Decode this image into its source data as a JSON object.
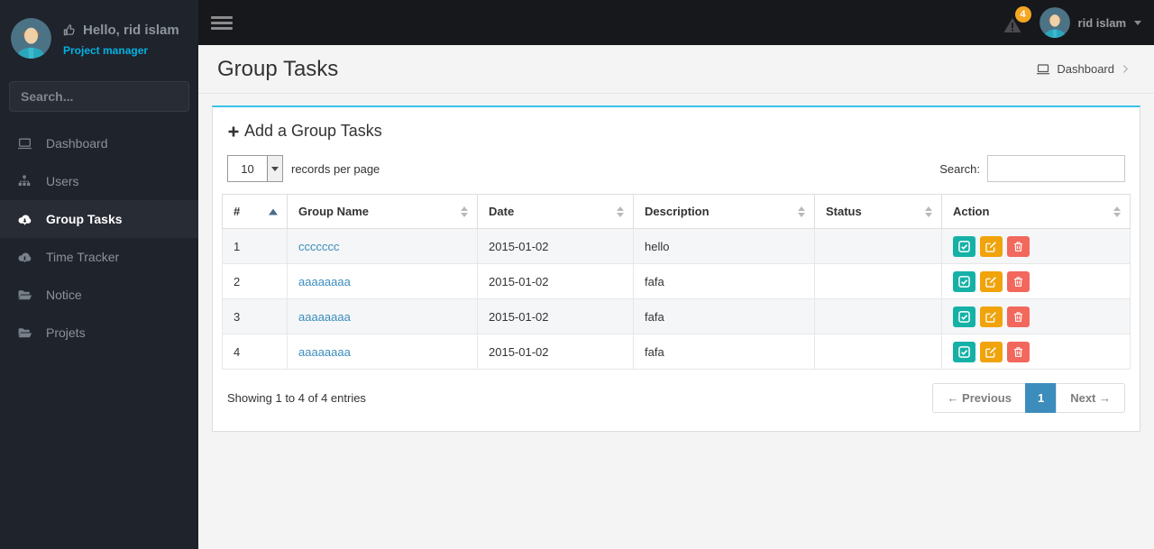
{
  "sidebar": {
    "user": {
      "greeting": "Hello, rid islam",
      "role": "Project manager"
    },
    "search_placeholder": "Search...",
    "items": [
      {
        "label": "Dashboard",
        "icon": "laptop-icon",
        "active": false
      },
      {
        "label": "Users",
        "icon": "sitemap-icon",
        "active": false
      },
      {
        "label": "Group Tasks",
        "icon": "cloud-download-icon",
        "active": true
      },
      {
        "label": "Time Tracker",
        "icon": "cloud-download-icon",
        "active": false
      },
      {
        "label": "Notice",
        "icon": "folder-open-icon",
        "active": false
      },
      {
        "label": "Projets",
        "icon": "folder-open-icon",
        "active": false
      }
    ]
  },
  "topbar": {
    "notification_count": "4",
    "username": "rid islam"
  },
  "page": {
    "title": "Group Tasks",
    "breadcrumb": "Dashboard"
  },
  "panel": {
    "heading": "Add a Group Tasks",
    "controls": {
      "per_page_value": "10",
      "per_page_label": "records per page",
      "search_label": "Search:",
      "search_value": ""
    },
    "table": {
      "columns": [
        {
          "label": "#",
          "sort": "asc"
        },
        {
          "label": "Group Name",
          "sort": "both"
        },
        {
          "label": "Date",
          "sort": "both"
        },
        {
          "label": "Description",
          "sort": "both"
        },
        {
          "label": "Status",
          "sort": "both"
        },
        {
          "label": "Action",
          "sort": "both"
        }
      ],
      "rows": [
        {
          "num": "1",
          "group_name": "ccccccc",
          "date": "2015-01-02",
          "description": "hello",
          "status": ""
        },
        {
          "num": "2",
          "group_name": "aaaaaaaa",
          "date": "2015-01-02",
          "description": "fafa",
          "status": ""
        },
        {
          "num": "3",
          "group_name": "aaaaaaaa",
          "date": "2015-01-02",
          "description": "fafa",
          "status": ""
        },
        {
          "num": "4",
          "group_name": "aaaaaaaa",
          "date": "2015-01-02",
          "description": "fafa",
          "status": ""
        }
      ]
    },
    "footer": {
      "showing": "Showing 1 to 4 of 4 entries",
      "pagination": {
        "previous": "← Previous",
        "page": "1",
        "next": "Next →"
      }
    }
  },
  "colors": {
    "sidebar_bg": "#1f232b",
    "topbar_bg": "#17181b",
    "panel_accent_cyan": "#38c3e8",
    "link_blue": "#3c8dbc",
    "pagination_active_blue": "#3c8dbc",
    "badge_orange": "#f5a623",
    "role_cyan": "#00b2e3",
    "button_teal": "#15b1a6",
    "button_orange": "#f0a30a",
    "button_red": "#f2685c"
  }
}
